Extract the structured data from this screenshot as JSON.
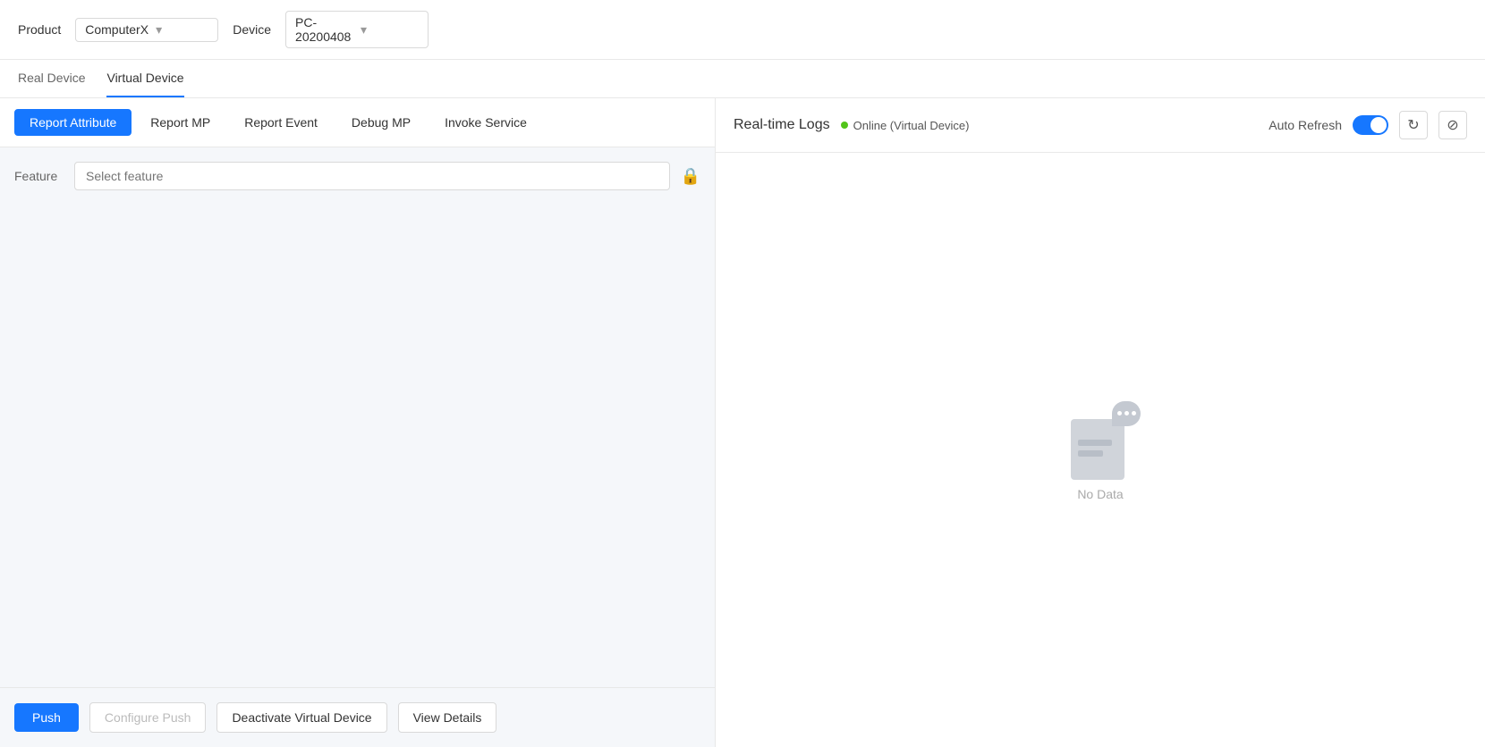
{
  "topBar": {
    "productLabel": "Product",
    "productValue": "ComputerX",
    "deviceLabel": "Device",
    "deviceValue": "PC-20200408"
  },
  "deviceTabs": [
    {
      "id": "real-device",
      "label": "Real Device",
      "active": false
    },
    {
      "id": "virtual-device",
      "label": "Virtual Device",
      "active": true
    }
  ],
  "innerTabs": [
    {
      "id": "report-attribute",
      "label": "Report Attribute",
      "active": true
    },
    {
      "id": "report-mp",
      "label": "Report MP",
      "active": false
    },
    {
      "id": "report-event",
      "label": "Report Event",
      "active": false
    },
    {
      "id": "debug-mp",
      "label": "Debug MP",
      "active": false
    },
    {
      "id": "invoke-service",
      "label": "Invoke Service",
      "active": false
    }
  ],
  "featureSection": {
    "label": "Feature",
    "placeholder": "Select feature"
  },
  "bottomActions": {
    "pushLabel": "Push",
    "configurePushLabel": "Configure Push",
    "deactivateLabel": "Deactivate Virtual Device",
    "viewDetailsLabel": "View Details"
  },
  "rightPanel": {
    "title": "Real-time Logs",
    "onlineStatus": "Online (Virtual Device)",
    "autoRefreshLabel": "Auto Refresh",
    "noDataLabel": "No Data"
  },
  "icons": {
    "chevronDown": "⌄",
    "lock": "🔒",
    "refresh": "↻",
    "eraser": "⌫"
  }
}
